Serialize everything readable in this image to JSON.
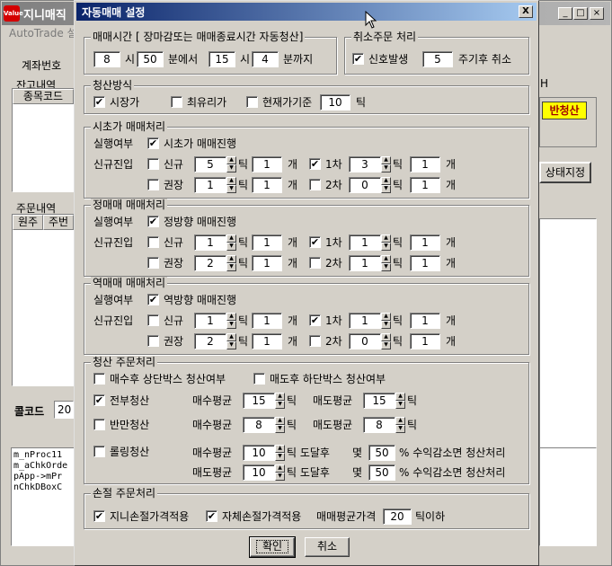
{
  "background": {
    "title": "지니매직",
    "menu": "AutoTrade 설",
    "account_label": "계좌번호",
    "balance_tab": "잔고내역",
    "code_col": "종목코드",
    "order_tab": "주문내역",
    "order_col1": "원주",
    "order_col2": "주번",
    "code_label": "콜코드",
    "code_value": "20",
    "right_label": "H",
    "yellow_badge": "반청산",
    "state_button": "상태지정",
    "log_lines": [
      "m_nProc11",
      "m_aChkOrde",
      "pApp->mPr",
      "nChkDBoxC"
    ]
  },
  "dialog": {
    "title": "자동매매 설정",
    "close_glyph": "X",
    "trade_time": {
      "legend": "매매시간 [ 장마감또는 매매종료시간 자동청산]",
      "start_hour": "8",
      "start_min": "50",
      "hour_unit": "시",
      "from_label": "분에서",
      "end_hour": "15",
      "end_min": "4",
      "to_label": "분까지"
    },
    "cancel_group": {
      "legend": "취소주문 처리",
      "signal_checked": "✔",
      "signal_label": "신호발생",
      "period_value": "5",
      "after_label": "주기후 취소"
    },
    "liquidation_method": {
      "legend": "청산방식",
      "market_checked": "✔",
      "market_label": "시장가",
      "best_checked": "",
      "best_label": "최유리가",
      "current_checked": "",
      "current_label": "현재가기준",
      "tick_value": "10",
      "tick_label": "틱"
    },
    "common": {
      "exec_label": "실행여부",
      "entry_label": "신규진입",
      "new_label": "신규",
      "recommend_label": "권장",
      "first_label": "1차",
      "second_label": "2차",
      "tick_unit": "틱",
      "count_unit": "개"
    },
    "open_price": {
      "legend": "시초가 매매처리",
      "exec_checked": "✔",
      "exec_text": "시초가 매매진행",
      "new_checked": "",
      "new_tick": "5",
      "new_count": "1",
      "first_checked": "✔",
      "first_tick": "3",
      "first_count": "1",
      "rec_checked": "",
      "rec_tick": "1",
      "rec_count": "1",
      "second_checked": "",
      "second_tick": "0",
      "second_count": "1"
    },
    "forward": {
      "legend": "정매매 매매처리",
      "exec_checked": "✔",
      "exec_text": "정방향 매매진행",
      "new_checked": "",
      "new_tick": "1",
      "new_count": "1",
      "first_checked": "✔",
      "first_tick": "1",
      "first_count": "1",
      "rec_checked": "",
      "rec_tick": "2",
      "rec_count": "1",
      "second_checked": "",
      "second_tick": "1",
      "second_count": "1"
    },
    "reverse": {
      "legend": "역매매 매매처리",
      "exec_checked": "✔",
      "exec_text": "역방향 매매진행",
      "new_checked": "",
      "new_tick": "1",
      "new_count": "1",
      "first_checked": "✔",
      "first_tick": "1",
      "first_count": "1",
      "rec_checked": "",
      "rec_tick": "2",
      "rec_count": "1",
      "second_checked": "",
      "second_tick": "0",
      "second_count": "1"
    },
    "liquidation_order": {
      "legend": "청산 주문처리",
      "upper_box_checked": "",
      "upper_box_label": "매수후 상단박스 청산여부",
      "lower_box_checked": "",
      "lower_box_label": "매도후 하단박스 청산여부",
      "full_checked": "✔",
      "full_label": "전부청산",
      "half_checked": "",
      "half_label": "반만청산",
      "rolling_checked": "",
      "rolling_label": "롤링청산",
      "buy_avg_label": "매수평균",
      "sell_avg_label": "매도평균",
      "full_buy": "15",
      "full_sell": "15",
      "half_buy": "8",
      "half_sell": "8",
      "roll_buy": "10",
      "roll_sell": "10",
      "reach_label": "틱 도달후",
      "several_label": "몇",
      "roll_buy_pct": "50",
      "roll_sell_pct": "50",
      "pct_label": "% 수익감소면 청산처리"
    },
    "stoploss": {
      "legend": "손절 주문처리",
      "genie_checked": "✔",
      "genie_label": "지니손절가격적용",
      "own_checked": "✔",
      "own_label": "자체손절가격적용",
      "avg_label": "매매평균가격",
      "avg_value": "20",
      "below_label": "틱이하"
    },
    "ok_button": "확인",
    "cancel_button": "취소"
  }
}
